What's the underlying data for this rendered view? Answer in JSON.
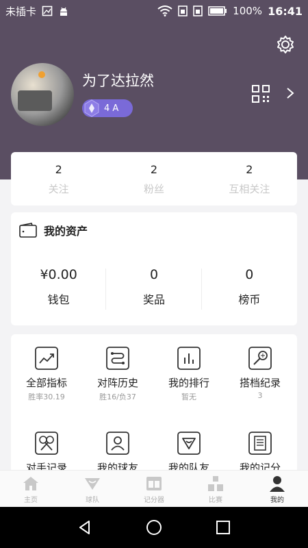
{
  "status_bar": {
    "carrier": "未插卡",
    "battery": "100%",
    "time": "16:41"
  },
  "profile": {
    "username": "为了达拉然",
    "level": "4 A"
  },
  "stats": [
    {
      "count": "2",
      "label": "关注"
    },
    {
      "count": "2",
      "label": "粉丝"
    },
    {
      "count": "2",
      "label": "互相关注"
    }
  ],
  "assets": {
    "title": "我的资产",
    "items": [
      {
        "value": "¥0.00",
        "label": "钱包"
      },
      {
        "value": "0",
        "label": "奖品"
      },
      {
        "value": "0",
        "label": "榜币"
      }
    ]
  },
  "menu": {
    "items": [
      {
        "label": "全部指标",
        "sub": "胜率30.19",
        "icon": "trend-chart-icon"
      },
      {
        "label": "对阵历史",
        "sub": "胜16/负37",
        "icon": "route-icon"
      },
      {
        "label": "我的排行",
        "sub": "暂无",
        "icon": "bar-chart-icon"
      },
      {
        "label": "搭档纪录",
        "sub": "3",
        "icon": "racket-icon"
      },
      {
        "label": "对手记录",
        "sub": "",
        "icon": "crossed-rackets-icon"
      },
      {
        "label": "我的球友",
        "sub": "",
        "icon": "person-icon"
      },
      {
        "label": "我的队友",
        "sub": "",
        "icon": "shield-icon"
      },
      {
        "label": "我的记分",
        "sub": "",
        "icon": "document-icon"
      }
    ]
  },
  "tabs": [
    {
      "label": "主页",
      "icon": "home-icon"
    },
    {
      "label": "球队",
      "icon": "team-icon"
    },
    {
      "label": "记分器",
      "icon": "scoreboard-icon"
    },
    {
      "label": "比赛",
      "icon": "match-icon"
    },
    {
      "label": "我的",
      "icon": "profile-icon"
    }
  ],
  "colors": {
    "header_bg": "#5a4e62",
    "level_badge": "#7a6ad8",
    "active_tab": "#333333"
  }
}
